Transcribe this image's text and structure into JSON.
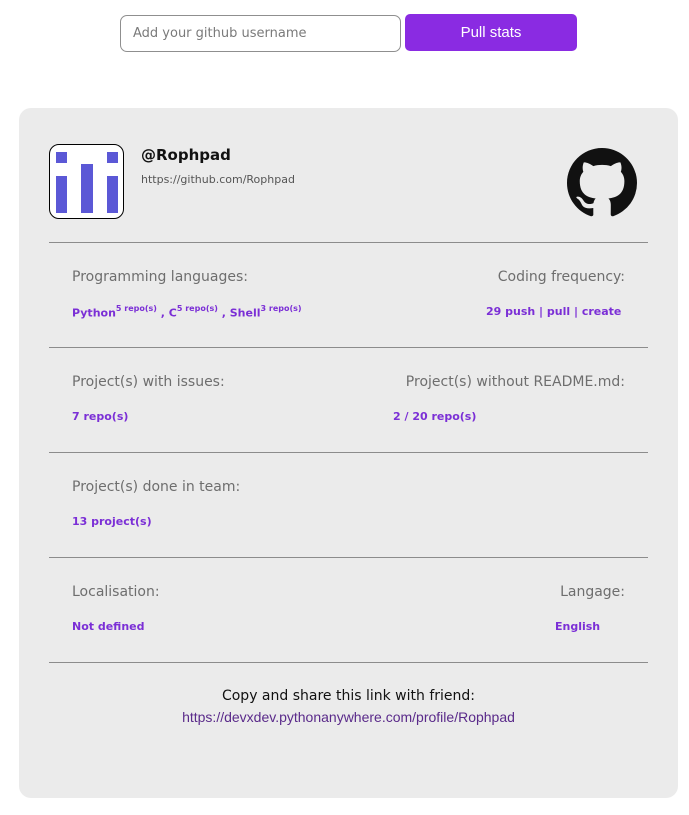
{
  "search": {
    "placeholder": "Add your github username",
    "value": "",
    "button_label": "Pull stats"
  },
  "profile": {
    "handle": "@Rophpad",
    "url": "https://github.com/Rophpad",
    "avatar_icon": "identicon",
    "logo_icon": "github-icon"
  },
  "stats": {
    "languages": {
      "label": "Programming languages:",
      "items": [
        {
          "name": "Python",
          "count": "5 repo(s)"
        },
        {
          "name": "C",
          "count": "5 repo(s)"
        },
        {
          "name": "Shell",
          "count": "3 repo(s)"
        }
      ],
      "separator": " , "
    },
    "frequency": {
      "label": "Coding frequency:",
      "value": "29 push | pull | create"
    },
    "issues": {
      "label": "Project(s) with issues:",
      "value": "7 repo(s)"
    },
    "readme": {
      "label": "Project(s) without README.md:",
      "value": "2 / 20 repo(s)"
    },
    "team": {
      "label": "Project(s) done in team:",
      "value": "13 project(s)"
    },
    "localisation": {
      "label": "Localisation:",
      "value": "Not defined"
    },
    "language": {
      "label": "Langage:",
      "value": "English"
    }
  },
  "share": {
    "text": "Copy and share this link with friend:",
    "link": "https://devxdev.pythonanywhere.com/profile/Rophpad"
  },
  "colors": {
    "accent": "#8a2be2",
    "value_text": "#7b2fd6",
    "card_bg": "#ebebeb",
    "avatar_blocks": "#5b58d6"
  }
}
